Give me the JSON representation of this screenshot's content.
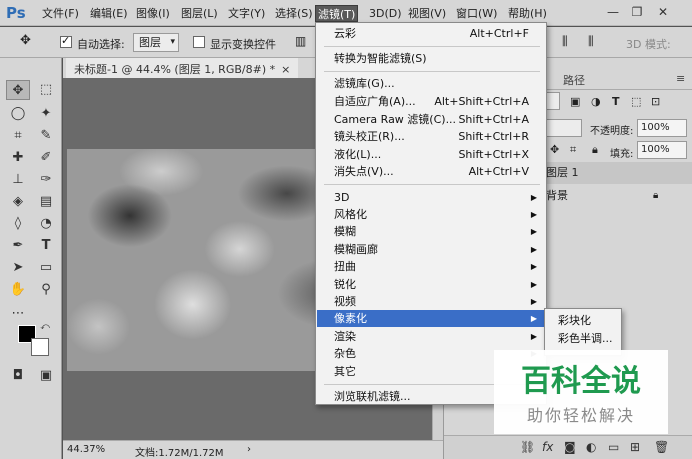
{
  "app": {
    "logo": "Ps"
  },
  "menubar": {
    "items": [
      "文件(F)",
      "编辑(E)",
      "图像(I)",
      "图层(L)",
      "文字(Y)",
      "选择(S)",
      "滤镜(T)",
      "3D(D)",
      "视图(V)",
      "窗口(W)",
      "帮助(H)"
    ],
    "active": "滤镜(T)"
  },
  "window_controls": {
    "minimize": "—",
    "restore": "❐",
    "close": "✕"
  },
  "options": {
    "auto_select_label": "自动选择:",
    "auto_select_value": "图层",
    "show_transform_label": "显示变换控件",
    "mode_3d_label": "3D 模式:"
  },
  "document": {
    "tab_title": "未标题-1 @ 44.4% (图层 1, RGB/8#) *",
    "zoom": "44.37%",
    "doc_info": "文档:1.72M/1.72M"
  },
  "panel": {
    "tab_paths": "路径",
    "opacity_label": "不透明度:",
    "opacity_value": "100%",
    "fill_label": "填充:",
    "fill_value": "100%",
    "layers": [
      {
        "name": "图层 1",
        "selected": true
      },
      {
        "name": "背景",
        "selected": false
      }
    ],
    "bottom_icons": [
      "link-icon",
      "fx-icon",
      "mask-icon",
      "adjust-icon",
      "folder-icon",
      "new-layer-icon",
      "trash-icon"
    ]
  },
  "filter_menu": {
    "items": [
      {
        "label": "云彩",
        "shortcut": "Alt+Ctrl+F"
      },
      {
        "label": "转换为智能滤镜(S)",
        "shortcut": ""
      },
      {
        "label": "滤镜库(G)...",
        "shortcut": ""
      },
      {
        "label": "自适应广角(A)...",
        "shortcut": "Alt+Shift+Ctrl+A"
      },
      {
        "label": "Camera Raw 滤镜(C)...",
        "shortcut": "Shift+Ctrl+A"
      },
      {
        "label": "镜头校正(R)...",
        "shortcut": "Shift+Ctrl+R"
      },
      {
        "label": "液化(L)...",
        "shortcut": "Shift+Ctrl+X"
      },
      {
        "label": "消失点(V)...",
        "shortcut": "Alt+Ctrl+V"
      },
      {
        "label": "3D",
        "submenu": true
      },
      {
        "label": "风格化",
        "submenu": true
      },
      {
        "label": "模糊",
        "submenu": true
      },
      {
        "label": "模糊画廊",
        "submenu": true
      },
      {
        "label": "扭曲",
        "submenu": true
      },
      {
        "label": "锐化",
        "submenu": true
      },
      {
        "label": "视频",
        "submenu": true
      },
      {
        "label": "像素化",
        "submenu": true,
        "highlighted": true
      },
      {
        "label": "渲染",
        "submenu": true
      },
      {
        "label": "杂色",
        "submenu": true
      },
      {
        "label": "其它",
        "submenu": true
      },
      {
        "label": "浏览联机滤镜...",
        "shortcut": ""
      }
    ]
  },
  "pixelate_submenu": {
    "items": [
      "彩块化",
      "彩色半调..."
    ]
  },
  "watermark": {
    "title": "百科全说",
    "subtitle": "助你轻松解决"
  },
  "colors": {
    "highlight": "#3a6ec7",
    "watermark_green": "#1f9a4f"
  }
}
